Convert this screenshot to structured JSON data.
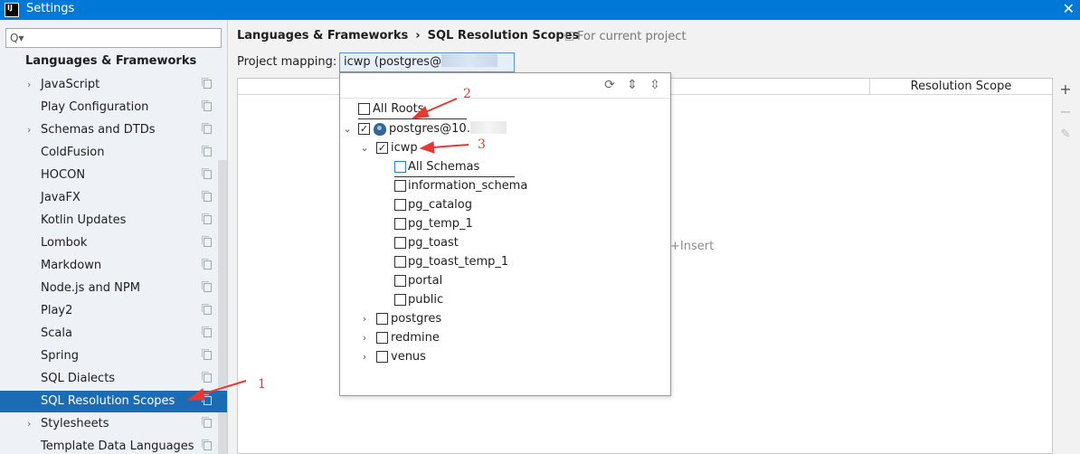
{
  "window": {
    "title": "Settings",
    "app_icon": "intellij-icon"
  },
  "sidebar": {
    "search_placeholder": "",
    "section_title": "Languages & Frameworks",
    "items": [
      {
        "label": "JavaScript",
        "expandable": true
      },
      {
        "label": "Play Configuration",
        "expandable": false
      },
      {
        "label": "Schemas and DTDs",
        "expandable": true
      },
      {
        "label": "ColdFusion",
        "expandable": false
      },
      {
        "label": "HOCON",
        "expandable": false
      },
      {
        "label": "JavaFX",
        "expandable": false
      },
      {
        "label": "Kotlin Updates",
        "expandable": false
      },
      {
        "label": "Lombok",
        "expandable": false
      },
      {
        "label": "Markdown",
        "expandable": false
      },
      {
        "label": "Node.js and NPM",
        "expandable": false
      },
      {
        "label": "Play2",
        "expandable": false
      },
      {
        "label": "Scala",
        "expandable": false
      },
      {
        "label": "Spring",
        "expandable": false
      },
      {
        "label": "SQL Dialects",
        "expandable": false
      },
      {
        "label": "SQL Resolution Scopes",
        "expandable": false,
        "selected": true
      },
      {
        "label": "Stylesheets",
        "expandable": true
      },
      {
        "label": "Template Data Languages",
        "expandable": false
      }
    ]
  },
  "main": {
    "breadcrumb": [
      "Languages & Frameworks",
      "SQL Resolution Scopes"
    ],
    "breadcrumb_separator": "›",
    "for_project": "For current project",
    "mapping_label": "Project mapping:",
    "mapping_value": "icwp (postgres@",
    "table": {
      "col_scope": "Resolution Scope",
      "empty_text": "+Insert"
    },
    "tools": {
      "add": "+",
      "remove": "−",
      "edit": "✎"
    }
  },
  "popup": {
    "toolbar": [
      "refresh-icon",
      "expand-all-icon",
      "collapse-all-icon"
    ],
    "all_roots": "All Roots",
    "datasource": "postgres@10.",
    "database": "icwp",
    "schemas": [
      "All Schemas",
      "information_schema",
      "pg_catalog",
      "pg_temp_1",
      "pg_toast",
      "pg_toast_temp_1",
      "portal",
      "public"
    ],
    "other_databases": [
      "postgres",
      "redmine",
      "venus"
    ]
  },
  "annotations": [
    "1",
    "2",
    "3"
  ],
  "colors": {
    "titlebar": "#0078d7",
    "selection": "#1b6cb5",
    "annotation": "#e53935"
  }
}
